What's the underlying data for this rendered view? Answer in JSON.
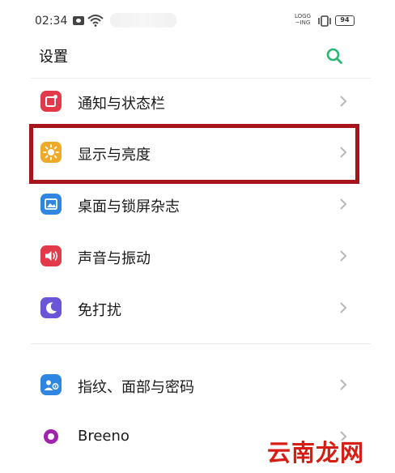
{
  "status_bar": {
    "time": "02:34",
    "speed_top": "LOGG",
    "speed_bottom": "~ING",
    "battery": "94"
  },
  "header": {
    "title": "设置",
    "search_icon": "search-icon"
  },
  "settings": {
    "items": [
      {
        "label": "通知与状态栏",
        "icon": "notification-icon",
        "color": "#e23a4b"
      },
      {
        "label": "显示与亮度",
        "icon": "brightness-icon",
        "color": "#f1a92a"
      },
      {
        "label": "桌面与锁屏杂志",
        "icon": "wallpaper-icon",
        "color": "#2f86e0"
      },
      {
        "label": "声音与振动",
        "icon": "sound-icon",
        "color": "#e23a4b"
      },
      {
        "label": "免打扰",
        "icon": "moon-icon",
        "color": "#6a55d6"
      },
      {
        "label": "指纹、面部与密码",
        "icon": "fingerprint-face-icon",
        "color": "#2f86e0"
      },
      {
        "label": "Breeno",
        "icon": "breeno-icon",
        "color": "#a222b0"
      }
    ]
  },
  "colors": {
    "accent": "#2bb673",
    "highlight": "#a8141b"
  },
  "watermark": "云南龙网"
}
